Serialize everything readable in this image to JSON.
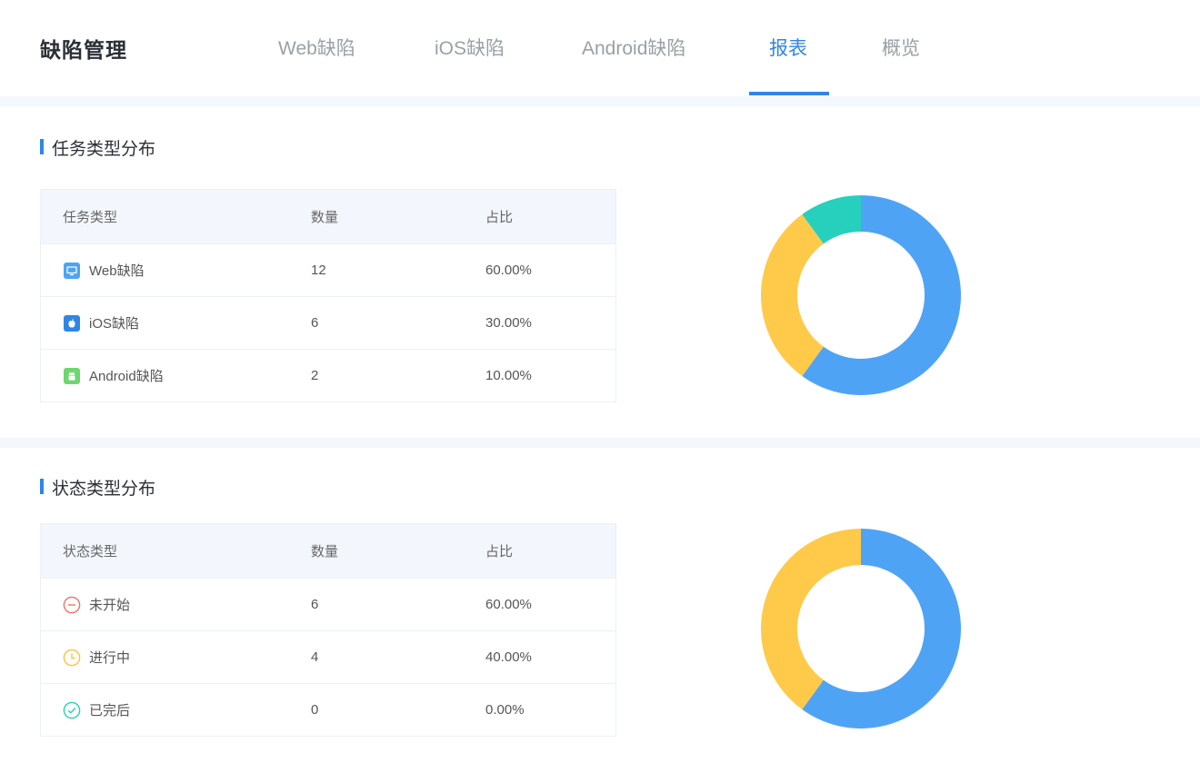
{
  "header": {
    "title": "缺陷管理",
    "tabs": [
      {
        "label": "Web缺陷",
        "active": false
      },
      {
        "label": "iOS缺陷",
        "active": false
      },
      {
        "label": "Android缺陷",
        "active": false
      },
      {
        "label": "报表",
        "active": true
      },
      {
        "label": "概览",
        "active": false
      }
    ]
  },
  "colors": {
    "accent": "#2f86e5",
    "web": "#4fa3f5",
    "ios": "#ffca4a",
    "android": "#26d0bd",
    "not_started": "#f07167",
    "in_progress": "#ffca4a",
    "done": "#26d0bd"
  },
  "task_section": {
    "title": "任务类型分布",
    "columns": [
      "任务类型",
      "数量",
      "占比"
    ],
    "rows": [
      {
        "icon": "monitor-icon",
        "name": "Web缺陷",
        "count": "12",
        "ratio": "60.00%"
      },
      {
        "icon": "apple-icon",
        "name": "iOS缺陷",
        "count": "6",
        "ratio": "30.00%"
      },
      {
        "icon": "android-icon",
        "name": "Android缺陷",
        "count": "2",
        "ratio": "10.00%"
      }
    ]
  },
  "status_section": {
    "title": "状态类型分布",
    "columns": [
      "状态类型",
      "数量",
      "占比"
    ],
    "rows": [
      {
        "icon": "minus-circle-icon",
        "name": "未开始",
        "count": "6",
        "ratio": "60.00%"
      },
      {
        "icon": "clock-icon",
        "name": "进行中",
        "count": "4",
        "ratio": "40.00%"
      },
      {
        "icon": "check-circle-icon",
        "name": "已完后",
        "count": "0",
        "ratio": "0.00%"
      }
    ]
  },
  "chart_data": [
    {
      "type": "pie",
      "categories": [
        "Web缺陷",
        "iOS缺陷",
        "Android缺陷"
      ],
      "values": [
        12,
        6,
        2
      ],
      "colors": [
        "#4fa3f5",
        "#ffca4a",
        "#26d0bd"
      ],
      "donut": true
    },
    {
      "type": "pie",
      "categories": [
        "未开始",
        "进行中",
        "已完后"
      ],
      "values": [
        6,
        4,
        0
      ],
      "colors": [
        "#4fa3f5",
        "#ffca4a",
        "#26d0bd"
      ],
      "donut": true
    }
  ]
}
